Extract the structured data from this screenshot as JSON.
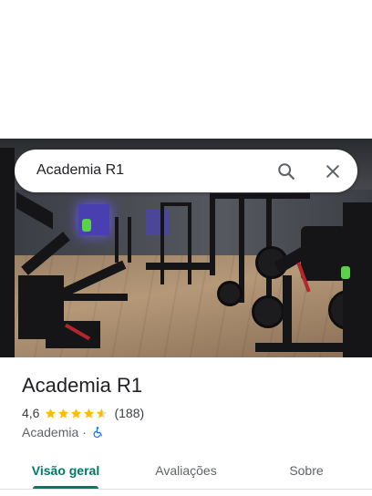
{
  "search": {
    "query": "Academia R1"
  },
  "place": {
    "name": "Academia R1",
    "rating": "4,6",
    "rating_value": 4.6,
    "review_count": "(188)",
    "category": "Academia",
    "separator": "·",
    "star_color": "#fbbc04",
    "accessibility_icon": "wheelchair-icon"
  },
  "tabs": [
    {
      "label": "Visão geral",
      "active": true
    },
    {
      "label": "Avaliações",
      "active": false
    },
    {
      "label": "Sobre",
      "active": false
    }
  ],
  "colors": {
    "accent": "#00796b",
    "accessibility": "#1a73e8"
  }
}
